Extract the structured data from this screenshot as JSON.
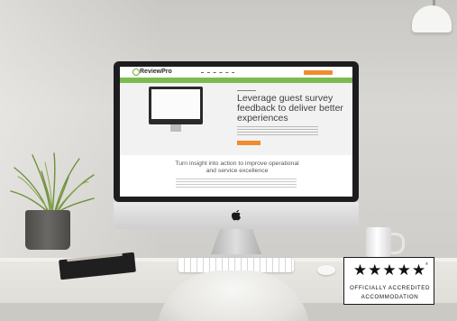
{
  "screen": {
    "logo": "ReviewPro",
    "headline": "Leverage guest survey feedback to deliver better experiences",
    "subheadline": "Turn insight into action to improve operational and service excellence"
  },
  "badge": {
    "stars": "★★★★★",
    "registered_mark": "®",
    "line1": "OFFICIALLY ACCREDITED",
    "line2": "ACCOMMODATION"
  },
  "colors": {
    "brand_green": "#7cbb4f",
    "cta_orange": "#f08c2e"
  }
}
